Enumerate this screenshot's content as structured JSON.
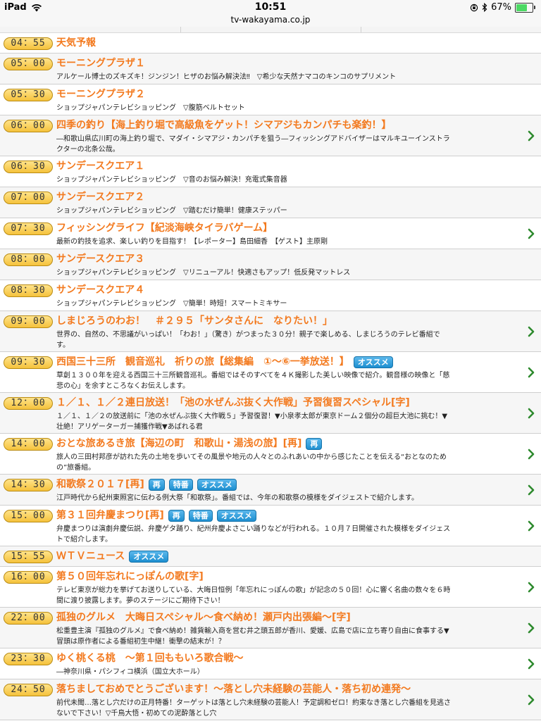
{
  "status_bar": {
    "device": "iPad",
    "time": "10:51",
    "battery": "67%",
    "battery_level": 0.67
  },
  "url": "tv-wakayama.co.jp",
  "programs": [
    {
      "time": "04：55",
      "title": "天気予報",
      "tags": [],
      "desc": "",
      "arrow": false
    },
    {
      "time": "05：00",
      "title": "モーニングプラザ１",
      "tags": [],
      "desc": "アルケール博士のズキズキ！ジンジン！ヒザのお悩み解決法‼　▽希少な天然ナマコのキンコのサプリメント",
      "arrow": false
    },
    {
      "time": "05：30",
      "title": "モーニングプラザ２",
      "tags": [],
      "desc": "ショップジャパンテレビショッピング　▽腹筋ベルトセット",
      "arrow": false
    },
    {
      "time": "06：00",
      "title": "四季の釣り【海上釣り堀で高級魚をゲット！シマアジもカンパチも楽釣！】",
      "tags": [],
      "desc": "―和歌山県広川町の海上釣り堀で、マダイ・シマアジ・カンパチを狙う―フィッシングアドバイザーはマルキユーインストラクターの北条公哉。",
      "arrow": true
    },
    {
      "time": "06：30",
      "title": "サンデースクエア１",
      "tags": [],
      "desc": "ショップジャパンテレビショッピング　▽音のお悩み解決！充電式集音器",
      "arrow": false
    },
    {
      "time": "07：00",
      "title": "サンデースクエア２",
      "tags": [],
      "desc": "ショップジャパンテレビショッピング　▽踏むだけ簡単！健康ステッパー",
      "arrow": false
    },
    {
      "time": "07：30",
      "title": "フィッシングライフ【紀淡海峡タイラバゲーム】",
      "tags": [],
      "desc": "最新の釣技を追求、楽しい釣りを目指す！【レポーター】島田細香　【ゲスト】主原剛",
      "arrow": true
    },
    {
      "time": "08：00",
      "title": "サンデースクエア３",
      "tags": [],
      "desc": "ショップジャパンテレビショッピング　▽リニューアル！快適さもアップ！低反発マットレス",
      "arrow": false
    },
    {
      "time": "08：30",
      "title": "サンデースクエア４",
      "tags": [],
      "desc": "ショップジャパンテレビショッピング　▽簡単！時短！スマートミキサー",
      "arrow": false
    },
    {
      "time": "09：00",
      "title": "しまじろうのわお！　＃２９５「サンタさんに　なりたい！」",
      "tags": [],
      "desc": "世界の、自然の、不思議がいっぱい！「わお！」（驚き）がつまった３０分！親子で楽しめる、しまじろうのテレビ番組です。",
      "arrow": true
    },
    {
      "time": "09：30",
      "title": "西国三十三所　観音巡礼　祈りの旅【総集編　①～⑥一挙放送！】",
      "tags": [
        "オススメ"
      ],
      "desc": "草創１３００年を迎える西国三十三所観音巡礼。番組ではそのすべてを４Ｋ撮影した美しい映像で紹介。観音様の映像と「慈悲の心」を余すところなくお伝えします。",
      "arrow": true
    },
    {
      "time": "12：00",
      "title": "１／１、１／２連日放送！「池の水ぜんぶ抜く大作戦」予習復習スペシャル[字]",
      "tags": [],
      "desc": "１／１、１／２の放送前に「池の水ぜんぶ抜く大作戦５」予習復習！▼小泉孝太郎が東京ドーム２個分の超巨大池に挑む！▼壮絶！アリゲーターガー捕獲作戦▼あばれる君",
      "arrow": true
    },
    {
      "time": "14：00",
      "title": "おとな旅あるき旅【海辺の町　和歌山・湯浅の旅】[再]",
      "tags": [
        "再"
      ],
      "desc": "旅人の三田村邦彦が訪れた先の土地を歩いてその風景や地元の人々とのふれあいの中から感じたことを伝える“おとなのための”旅番組。",
      "arrow": true
    },
    {
      "time": "14：30",
      "title": "和歌祭２０１７[再]",
      "tags": [
        "再",
        "特番",
        "オススメ"
      ],
      "desc": "江戸時代から紀州東照宮に伝わる例大祭「和歌祭」。番組では、今年の和歌祭の模様をダイジェストで紹介します。",
      "arrow": true
    },
    {
      "time": "15：00",
      "title": "第３１回弁慶まつり[再]",
      "tags": [
        "再",
        "特番",
        "オススメ"
      ],
      "desc": "弁慶まつりは演劇弁慶伝説、弁慶ゲタ踊り、紀州弁慶よさこい踊りなどが行われる。１０月７日開催された模様をダイジェストで紹介します。",
      "arrow": true
    },
    {
      "time": "15：55",
      "title": "ＷＴＶニュース",
      "tags": [
        "オススメ"
      ],
      "desc": "",
      "arrow": false
    },
    {
      "time": "16：00",
      "title": "第５０回年忘れにっぽんの歌[字]",
      "tags": [],
      "desc": "テレビ東京が総力を挙げてお送りしている、大晦日恒例「年忘れにっぽんの歌」が記念の５０回！心に響く名曲の数々を６時間に渡り披露します。夢のステージにご期待下さい！",
      "arrow": true
    },
    {
      "time": "22：00",
      "title": "孤独のグルメ　大晦日スペシャル～食べ納め！瀬戸内出張編～[字]",
      "tags": [],
      "desc": "松重豊主演『孤独のグルメ』で食べ納め！雑貨輸入商を営む井之頭五郎が香川、愛媛、広島で店に立ち寄り自由に食事する▼冒頭は原作者による番組初生中継！衝撃の結末が！？",
      "arrow": true
    },
    {
      "time": "23：30",
      "title": "ゆく桃くる桃　～第１回ももいろ歌合戦～",
      "tags": [],
      "desc": "―神奈川県・パシフィコ横浜（国立大ホール）",
      "arrow": true
    },
    {
      "time": "24：50",
      "title": "落ちましておめでとうございます！～落とし穴未経験の芸能人・落ち初め連発～",
      "tags": [],
      "desc": "前代未聞…落とし穴だけの正月特番！ターゲットは落とし穴未経験の芸能人！予定調和ゼロ！約束なき落とし穴番組を見逃さないで下さい！▽千鳥大悟・初めての泥酔落とし穴",
      "arrow": true
    }
  ]
}
